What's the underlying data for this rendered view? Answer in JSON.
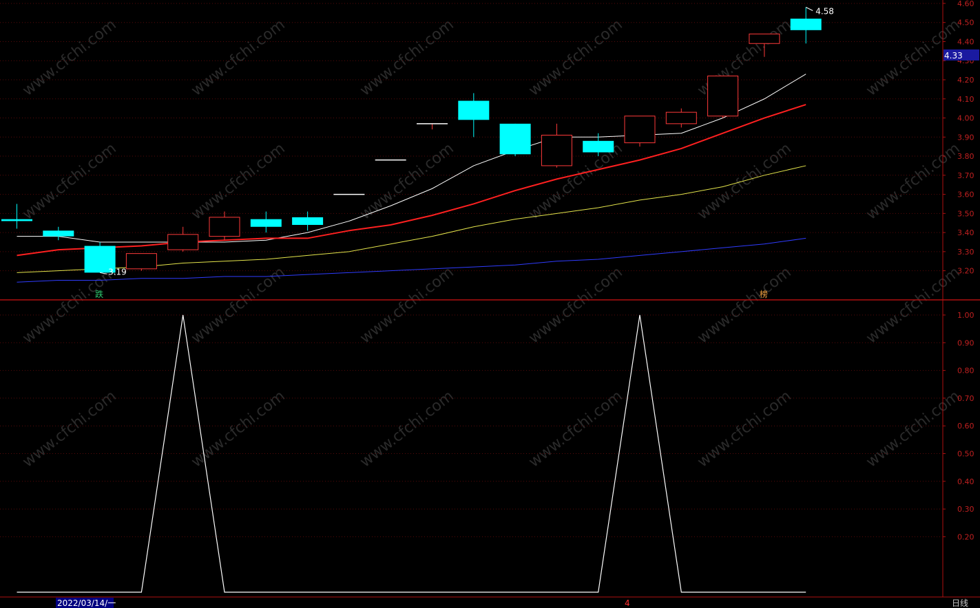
{
  "chart_data": [
    {
      "type": "candlestick",
      "title": "",
      "price_axis_ticks": [
        "3.20",
        "3.30",
        "3.40",
        "3.50",
        "3.60",
        "3.70",
        "3.80",
        "3.90",
        "4.00",
        "4.10",
        "4.20",
        "4.30",
        "4.40",
        "4.50",
        "4.60"
      ],
      "ylim": [
        3.12,
        4.6
      ],
      "current_price_label": "4.33",
      "high_marker": "4.58",
      "low_marker": "3.19",
      "markers": [
        {
          "text": "跌",
          "color": "#2ecc71",
          "candle": 2
        },
        {
          "text": "榜",
          "color": "#f0a040",
          "candle": 18
        }
      ],
      "candles": [
        {
          "o": 3.47,
          "h": 3.55,
          "l": 3.42,
          "c": 3.46
        },
        {
          "o": 3.41,
          "h": 3.43,
          "l": 3.36,
          "c": 3.38
        },
        {
          "o": 3.33,
          "h": 3.35,
          "l": 3.19,
          "c": 3.19
        },
        {
          "o": 3.21,
          "h": 3.29,
          "l": 3.2,
          "c": 3.29
        },
        {
          "o": 3.31,
          "h": 3.43,
          "l": 3.3,
          "c": 3.39
        },
        {
          "o": 3.38,
          "h": 3.51,
          "l": 3.36,
          "c": 3.48
        },
        {
          "o": 3.47,
          "h": 3.51,
          "l": 3.4,
          "c": 3.43
        },
        {
          "o": 3.48,
          "h": 3.51,
          "l": 3.41,
          "c": 3.44
        },
        {
          "o": 3.6,
          "h": 3.6,
          "l": 3.6,
          "c": 3.6
        },
        {
          "o": 3.78,
          "h": 3.78,
          "l": 3.78,
          "c": 3.78
        },
        {
          "o": 3.97,
          "h": 3.97,
          "l": 3.94,
          "c": 3.97
        },
        {
          "o": 4.09,
          "h": 4.13,
          "l": 3.9,
          "c": 3.99
        },
        {
          "o": 3.97,
          "h": 3.97,
          "l": 3.8,
          "c": 3.81
        },
        {
          "o": 3.75,
          "h": 3.97,
          "l": 3.74,
          "c": 3.91
        },
        {
          "o": 3.88,
          "h": 3.92,
          "l": 3.8,
          "c": 3.82
        },
        {
          "o": 3.87,
          "h": 4.01,
          "l": 3.85,
          "c": 4.01
        },
        {
          "o": 3.97,
          "h": 4.05,
          "l": 3.95,
          "c": 4.03
        },
        {
          "o": 4.01,
          "h": 4.22,
          "l": 4.0,
          "c": 4.22
        },
        {
          "o": 4.39,
          "h": 4.44,
          "l": 4.32,
          "c": 4.44
        },
        {
          "o": 4.52,
          "h": 4.58,
          "l": 4.39,
          "c": 4.46
        }
      ],
      "series": [
        {
          "color": "#ffffff",
          "values": [
            3.38,
            3.38,
            3.35,
            3.35,
            3.35,
            3.35,
            3.36,
            3.4,
            3.46,
            3.54,
            3.63,
            3.75,
            3.83,
            3.9,
            3.9,
            3.91,
            3.92,
            4.0,
            4.1,
            4.23
          ]
        },
        {
          "color": "#ff2020",
          "values": [
            3.28,
            3.31,
            3.32,
            3.33,
            3.35,
            3.36,
            3.37,
            3.37,
            3.41,
            3.44,
            3.49,
            3.55,
            3.62,
            3.68,
            3.73,
            3.78,
            3.84,
            3.92,
            4.0,
            4.07
          ]
        },
        {
          "color": "#e6e64c",
          "values": [
            3.19,
            3.2,
            3.21,
            3.22,
            3.24,
            3.25,
            3.26,
            3.28,
            3.3,
            3.34,
            3.38,
            3.43,
            3.47,
            3.5,
            3.53,
            3.57,
            3.6,
            3.64,
            3.7,
            3.75
          ]
        },
        {
          "color": "#2f3cff",
          "values": [
            3.14,
            3.15,
            3.15,
            3.16,
            3.16,
            3.17,
            3.17,
            3.18,
            3.19,
            3.2,
            3.21,
            3.22,
            3.23,
            3.25,
            3.26,
            3.28,
            3.3,
            3.32,
            3.34,
            3.37
          ]
        }
      ]
    },
    {
      "type": "line",
      "title": "",
      "y_axis_ticks": [
        "0.20",
        "0.30",
        "0.40",
        "0.50",
        "0.60",
        "0.70",
        "0.80",
        "0.90",
        "1.00"
      ],
      "ylim": [
        0,
        1.0
      ],
      "series": [
        {
          "color": "#ffffff",
          "values": [
            0,
            0,
            0,
            0,
            1,
            0,
            0,
            0,
            0,
            0,
            0,
            0,
            0,
            0,
            0,
            1,
            0,
            0,
            0,
            0
          ]
        }
      ]
    }
  ],
  "status_bar": {
    "date_label": "2022/03/14/一",
    "cursor_label": "4",
    "period_label": "日线"
  },
  "watermark": "www.cfchi.com"
}
